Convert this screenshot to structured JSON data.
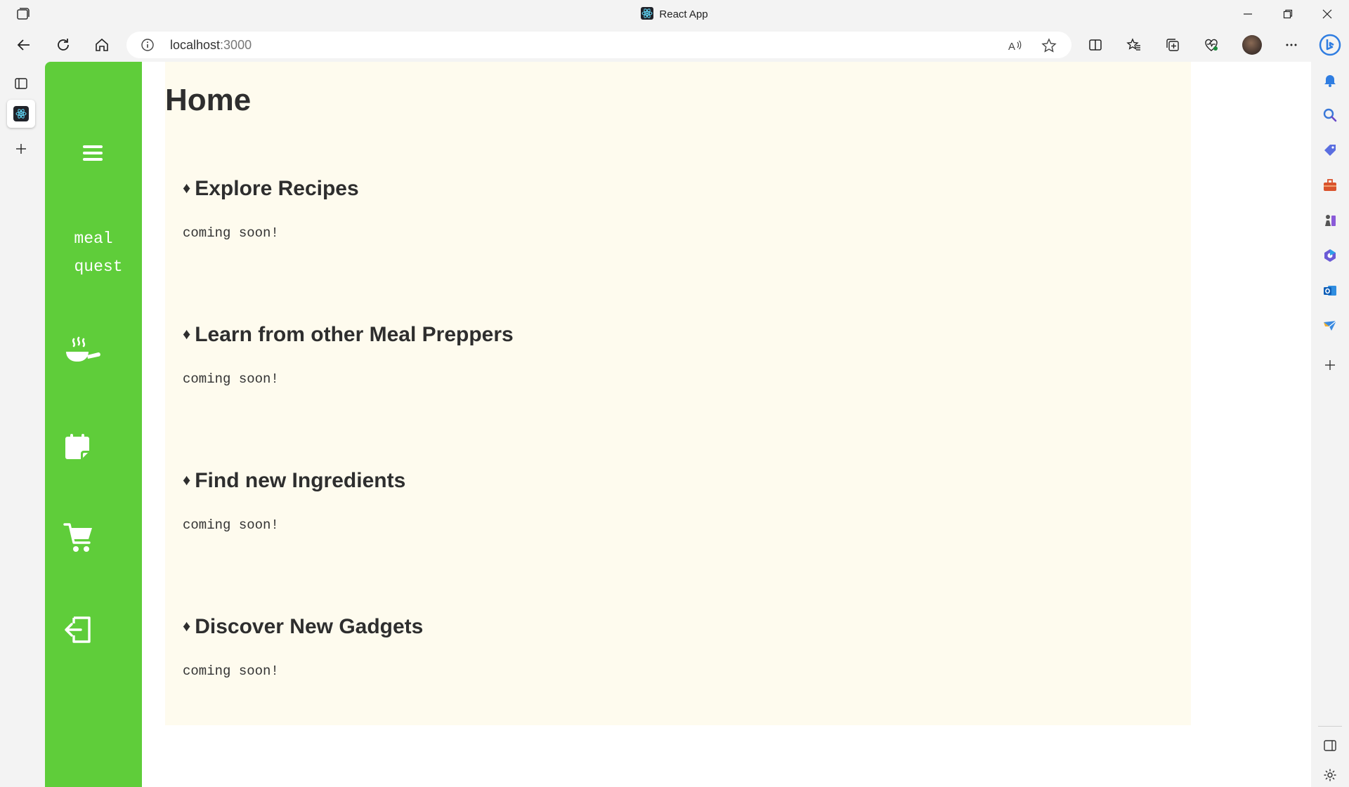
{
  "browser": {
    "tab_title": "React App",
    "url_host": "localhost",
    "url_port": ":3000"
  },
  "app": {
    "brand_line1": "meal",
    "brand_line2": "quest",
    "sidebar_icons": [
      "menu-icon",
      "cooking-pan-icon",
      "calendar-icon",
      "cart-icon",
      "logout-icon"
    ],
    "accent_color": "#5fcd3a",
    "content_bg": "#fefbee"
  },
  "main": {
    "title": "Home",
    "sections": [
      {
        "heading": "Explore Recipes",
        "body": "coming soon!"
      },
      {
        "heading": "Learn from other Meal Preppers",
        "body": "coming soon!"
      },
      {
        "heading": "Find new Ingredients",
        "body": "coming soon!"
      },
      {
        "heading": "Discover New Gadgets",
        "body": "coming soon!"
      }
    ],
    "bullet": "♦"
  }
}
